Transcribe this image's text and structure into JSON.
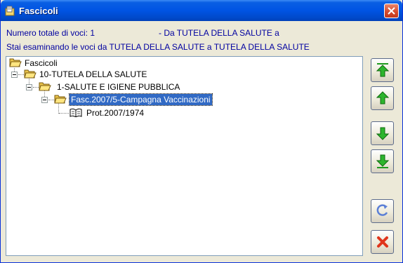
{
  "window": {
    "title": "Fascicoli"
  },
  "info": {
    "total_label": "Numero totale di voci: 1",
    "range_label": "- Da TUTELA DELLA SALUTE a",
    "viewing_label": "Stai esaminando le voci da TUTELA DELLA SALUTE a TUTELA DELLA SALUTE"
  },
  "tree": {
    "root": "Fascicoli",
    "level1": "10-TUTELA DELLA SALUTE",
    "level2": "1-SALUTE E IGIENE PUBBLICA",
    "level3": "Fasc.2007/5-Campagna Vaccinazioni",
    "level4": "Prot.2007/1974"
  },
  "buttons": {
    "icons": [
      "move-first-icon",
      "move-up-icon",
      "move-down-icon",
      "move-last-icon",
      "refresh-icon",
      "close-icon"
    ]
  },
  "colors": {
    "info_text": "#0000a0",
    "selection": "#316ac5",
    "arrow_green": "#1f9a1f"
  }
}
